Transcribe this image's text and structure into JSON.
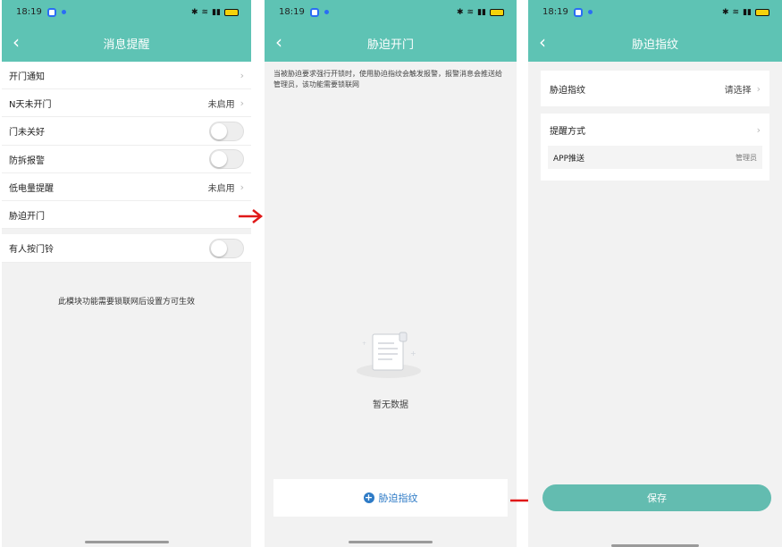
{
  "status": {
    "time": "18:19",
    "signal_text": "ᵃˡˡ ᵃˡˡ"
  },
  "screen1": {
    "title": "消息提醒",
    "rows": [
      {
        "label": "开门通知",
        "value": ""
      },
      {
        "label": "N天未开门",
        "value": "未启用"
      },
      {
        "label": "门未关好",
        "value": ""
      },
      {
        "label": "防拆报警",
        "value": ""
      },
      {
        "label": "低电量提醒",
        "value": "未启用"
      },
      {
        "label": "胁迫开门",
        "value": ""
      },
      {
        "label": "有人按门铃",
        "value": ""
      }
    ],
    "note": "此模块功能需要锁联网后设置方可生效"
  },
  "screen2": {
    "title": "胁迫开门",
    "description": "当被胁迫要求强行开锁时，使用胁迫指纹会触发报警，报警消息会推送给管理员，该功能需要锁联网",
    "empty_text": "暂无数据",
    "add_label": "胁迫指纹"
  },
  "screen3": {
    "title": "胁迫指纹",
    "fingerprint_label": "胁迫指纹",
    "fingerprint_value": "请选择",
    "remind_label": "提醒方式",
    "push_label": "APP推送",
    "push_value": "管理员",
    "save_label": "保存"
  },
  "colors": {
    "header": "#5ec3b4",
    "arrow": "#e01818",
    "accent_blue": "#2e7bc6",
    "save_button": "#63bcb0"
  }
}
